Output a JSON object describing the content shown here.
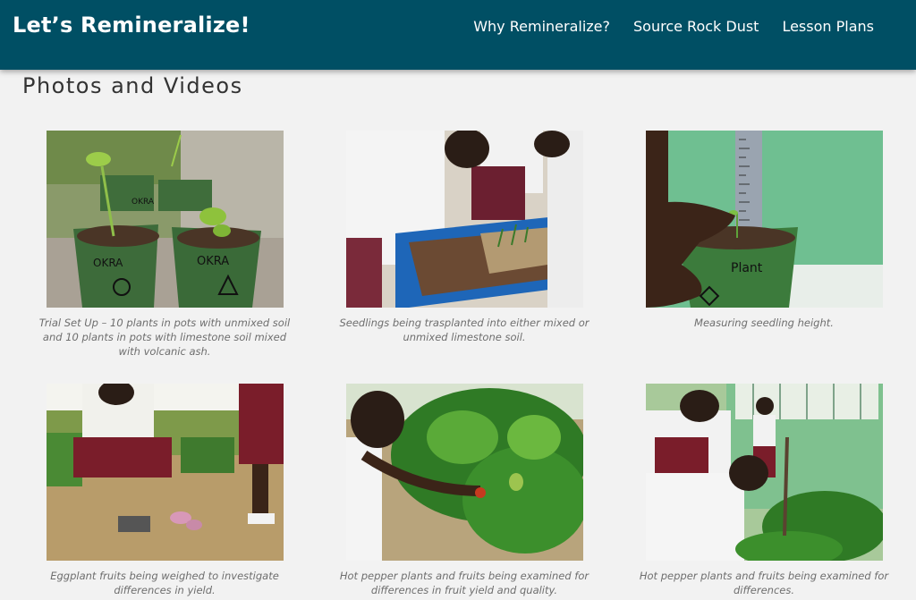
{
  "site": {
    "title": "Let’s Remineralize!"
  },
  "nav": [
    {
      "label": "Why Remineralize?"
    },
    {
      "label": "Source Rock Dust"
    },
    {
      "label": "Lesson Plans"
    }
  ],
  "page": {
    "title": "Photos and Videos"
  },
  "gallery": [
    {
      "caption": "Trial Set Up – 10 plants in pots with unmixed soil and 10 plants in pots with limestone soil mixed with volcanic ash.",
      "labels": [
        "OKRA",
        "OKRA",
        "OKRA"
      ]
    },
    {
      "caption": "Seedlings being trasplanted into either mixed or unmixed limestone soil."
    },
    {
      "caption": "Measuring seedling height.",
      "labels": [
        "Plant"
      ]
    },
    {
      "caption": "Eggplant fruits being weighed to investigate differences in yield."
    },
    {
      "caption": "Hot pepper plants and fruits being examined for differences in fruit yield and quality."
    },
    {
      "caption": "Hot pepper plants and fruits being examined for differences."
    }
  ]
}
